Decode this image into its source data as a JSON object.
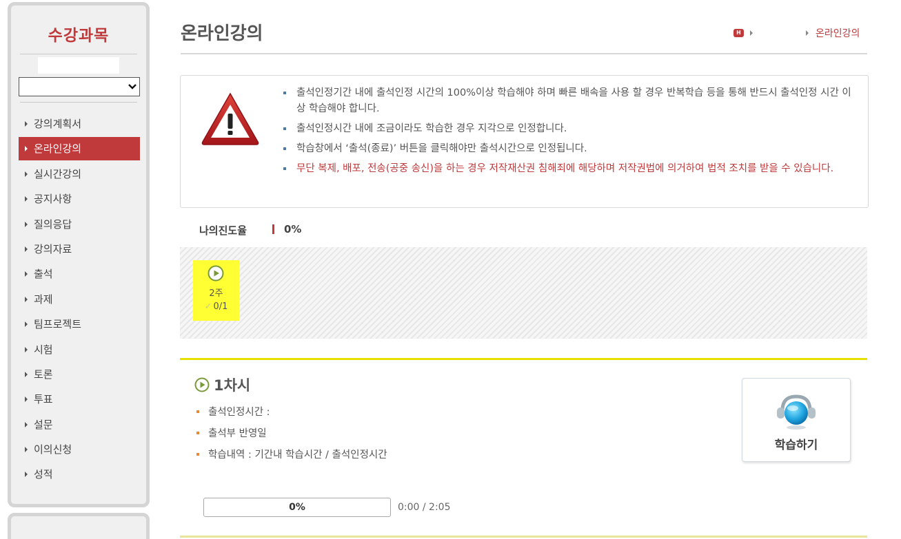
{
  "sidebar": {
    "title": "수강과목",
    "course_select_value": "",
    "items": [
      {
        "label": "강의계획서"
      },
      {
        "label": "온라인강의",
        "active": true
      },
      {
        "label": "실시간강의"
      },
      {
        "label": "공지사항"
      },
      {
        "label": "질의응답"
      },
      {
        "label": "강의자료"
      },
      {
        "label": "출석"
      },
      {
        "label": "과제"
      },
      {
        "label": "팀프로젝트"
      },
      {
        "label": "시험"
      },
      {
        "label": "토론"
      },
      {
        "label": "투표"
      },
      {
        "label": "설문"
      },
      {
        "label": "이의신청"
      },
      {
        "label": "성적"
      }
    ]
  },
  "header": {
    "title": "온라인강의",
    "breadcrumb_home_icon": "home-icon",
    "breadcrumb_home_text": "H",
    "breadcrumb_current": "온라인강의"
  },
  "notice": {
    "icon": "warning-icon",
    "items": [
      {
        "text": "출석인정기간 내에 출석인정 시간의 100%이상 학습해야 하며 빠른 배속을 사용 할 경우 반복학습 등을 통해 반드시 출석인정 시간 이상 학습해야 합니다.",
        "red": false
      },
      {
        "text": "출석인정시간 내에 조금이라도 학습한 경우 지각으로 인정합니다.",
        "red": false
      },
      {
        "text": "학습창에서 ‘출석(종료)’ 버튼을 클릭해야만 출석시간으로 인정됩니다.",
        "red": false
      },
      {
        "text": "무단 복제, 배포, 전송(공중 송신)을 하는 경우 저작재산권 침해죄에 해당하며 저작권법에 의거하여 법적 조치를 받을 수 있습니다.",
        "red": true
      }
    ]
  },
  "progress": {
    "label": "나의진도율",
    "value": "0%"
  },
  "weeks": [
    {
      "week": "2주",
      "count": "0/1",
      "check_glyph": "✓"
    }
  ],
  "session": {
    "title": "1차시",
    "details": [
      "출석인정시간 :",
      "출석부 반영일",
      "학습내역 : 기간내 학습시간 / 출석인정시간"
    ],
    "study_button_label": "학습하기",
    "lecture_progress": "0%",
    "lecture_progress_fraction": 0,
    "lecture_time": "0:00 / 2:05"
  },
  "colors": {
    "accent": "#c0393b",
    "week_highlight": "#ffff33",
    "session_line": "#e5e000"
  }
}
